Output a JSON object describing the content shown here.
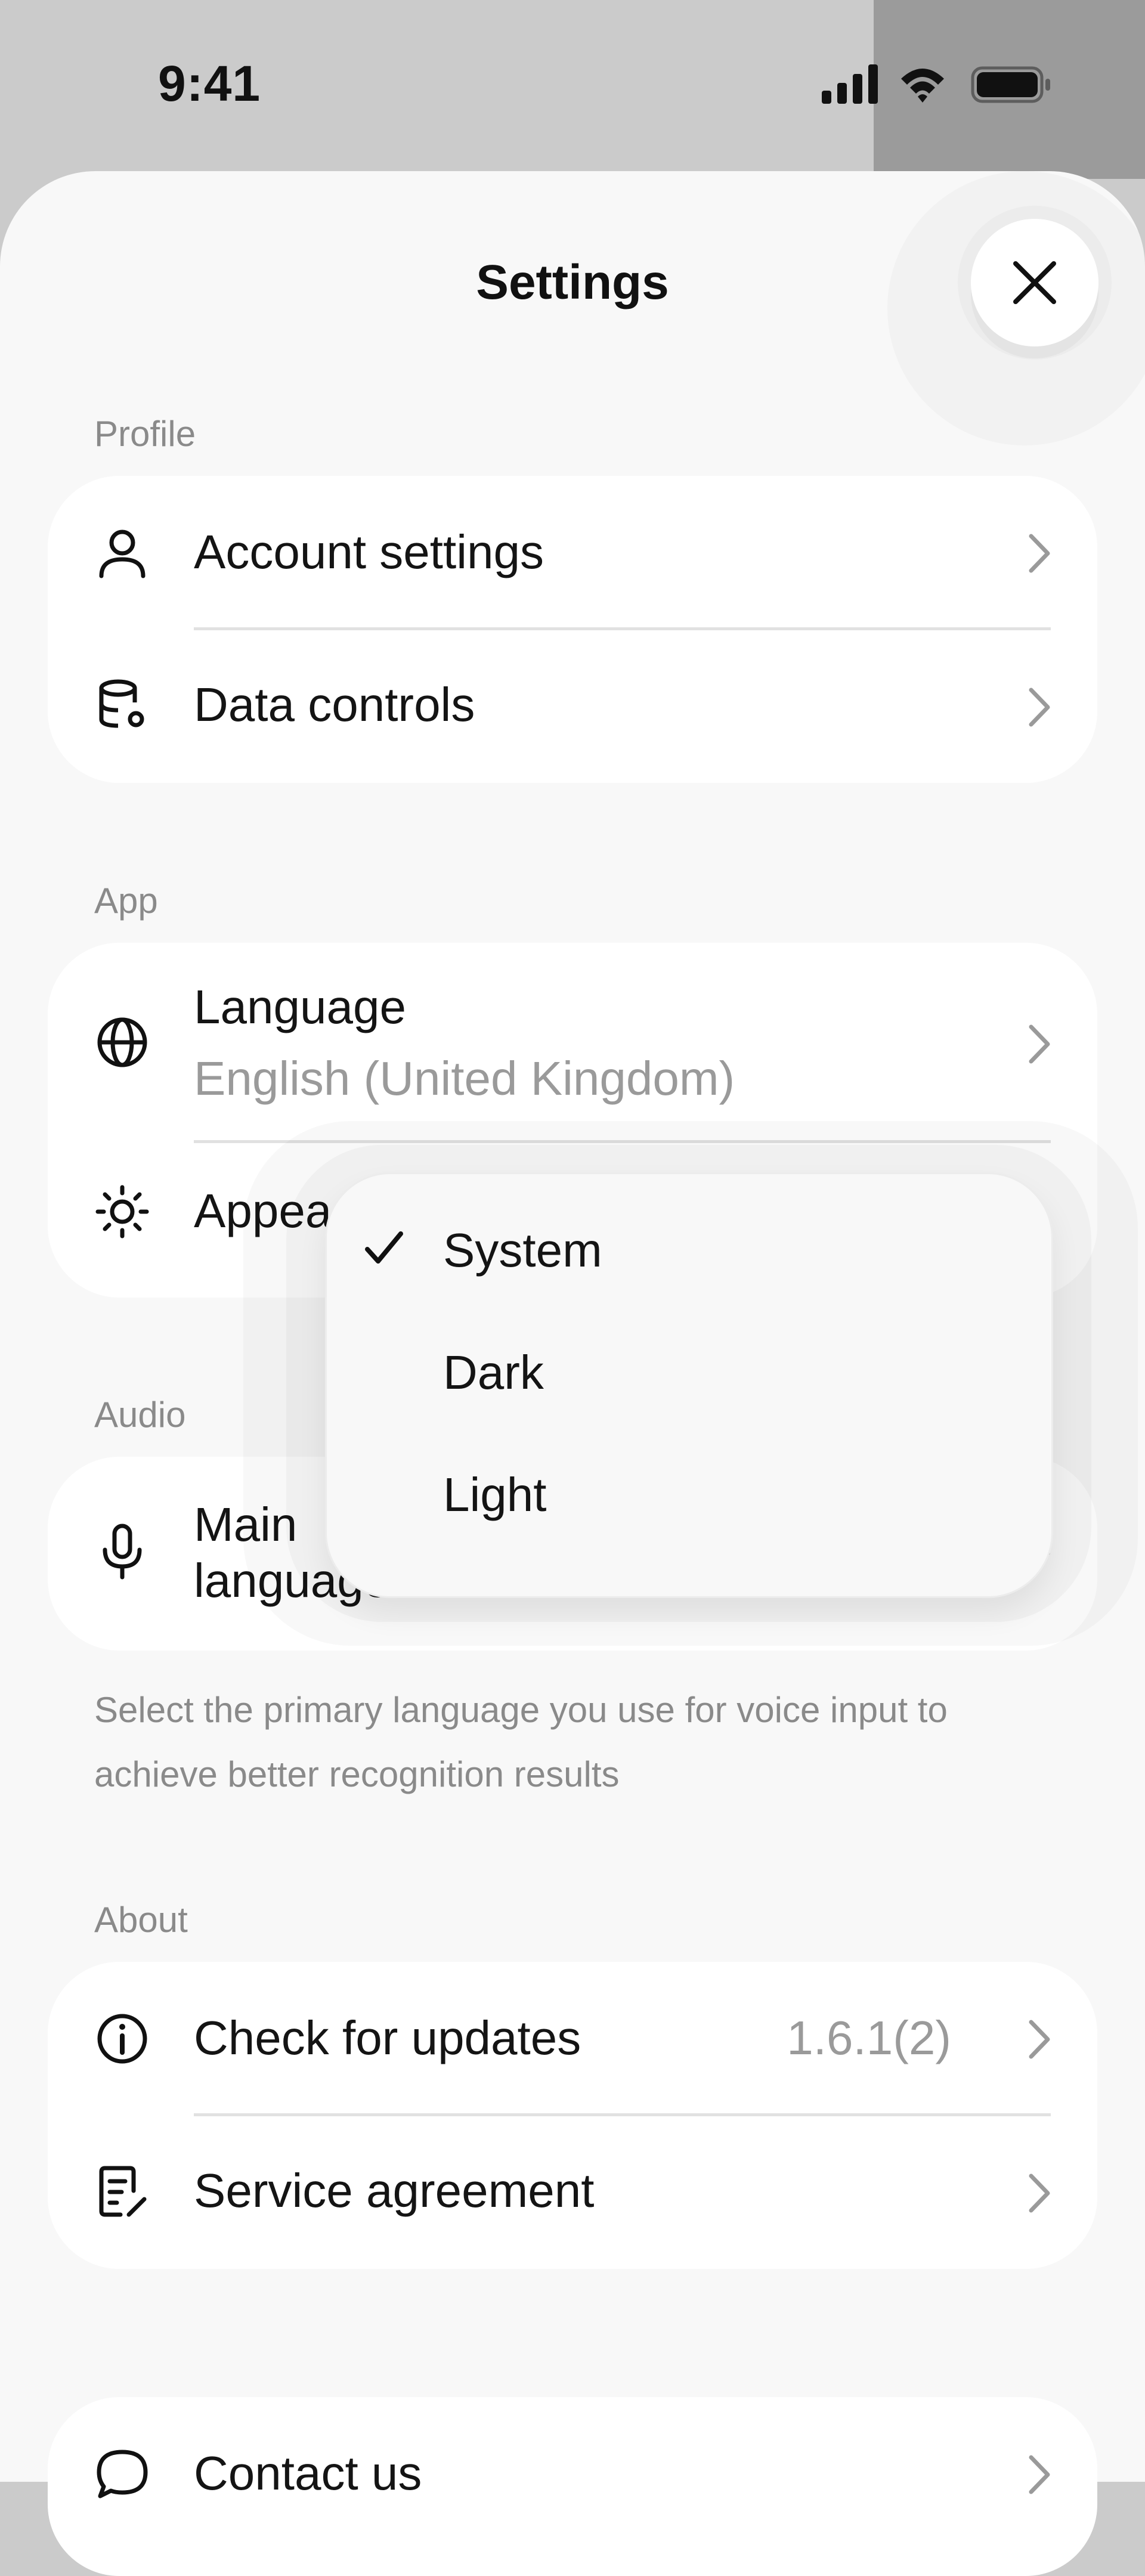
{
  "status_bar": {
    "time": "9:41",
    "icons": [
      "signal-icon",
      "wifi-icon",
      "battery-icon"
    ]
  },
  "sheet": {
    "title": "Settings",
    "close_icon": "close-icon"
  },
  "sections": {
    "profile": {
      "label": "Profile",
      "items": [
        {
          "label": "Account settings",
          "icon": "user-icon"
        },
        {
          "label": "Data controls",
          "icon": "database-settings-icon"
        }
      ]
    },
    "app": {
      "label": "App",
      "items": [
        {
          "label": "Language",
          "value": "English (United Kingdom)",
          "icon": "globe-icon"
        },
        {
          "label": "Appea",
          "icon": "sun-icon"
        }
      ]
    },
    "audio": {
      "label": "Audio",
      "items": [
        {
          "label_line1": "Main",
          "label_line2": "language",
          "icon": "microphone-icon"
        }
      ],
      "hint": "Select the primary language you use for voice input to achieve better recognition results"
    },
    "about": {
      "label": "About",
      "items": [
        {
          "label": "Check for updates",
          "value": "1.6.1(2)",
          "icon": "info-icon"
        },
        {
          "label": "Service agreement",
          "icon": "document-edit-icon"
        }
      ]
    },
    "contact": {
      "items": [
        {
          "label": "Contact us",
          "icon": "chat-bubble-icon"
        }
      ]
    }
  },
  "appearance_menu": {
    "selected": "System",
    "options": [
      "System",
      "Dark",
      "Light"
    ]
  },
  "colors": {
    "accent_text": "#141414",
    "secondary_text": "#9a9a9a",
    "card_bg": "#ffffff",
    "sheet_bg": "#f8f8f8"
  }
}
